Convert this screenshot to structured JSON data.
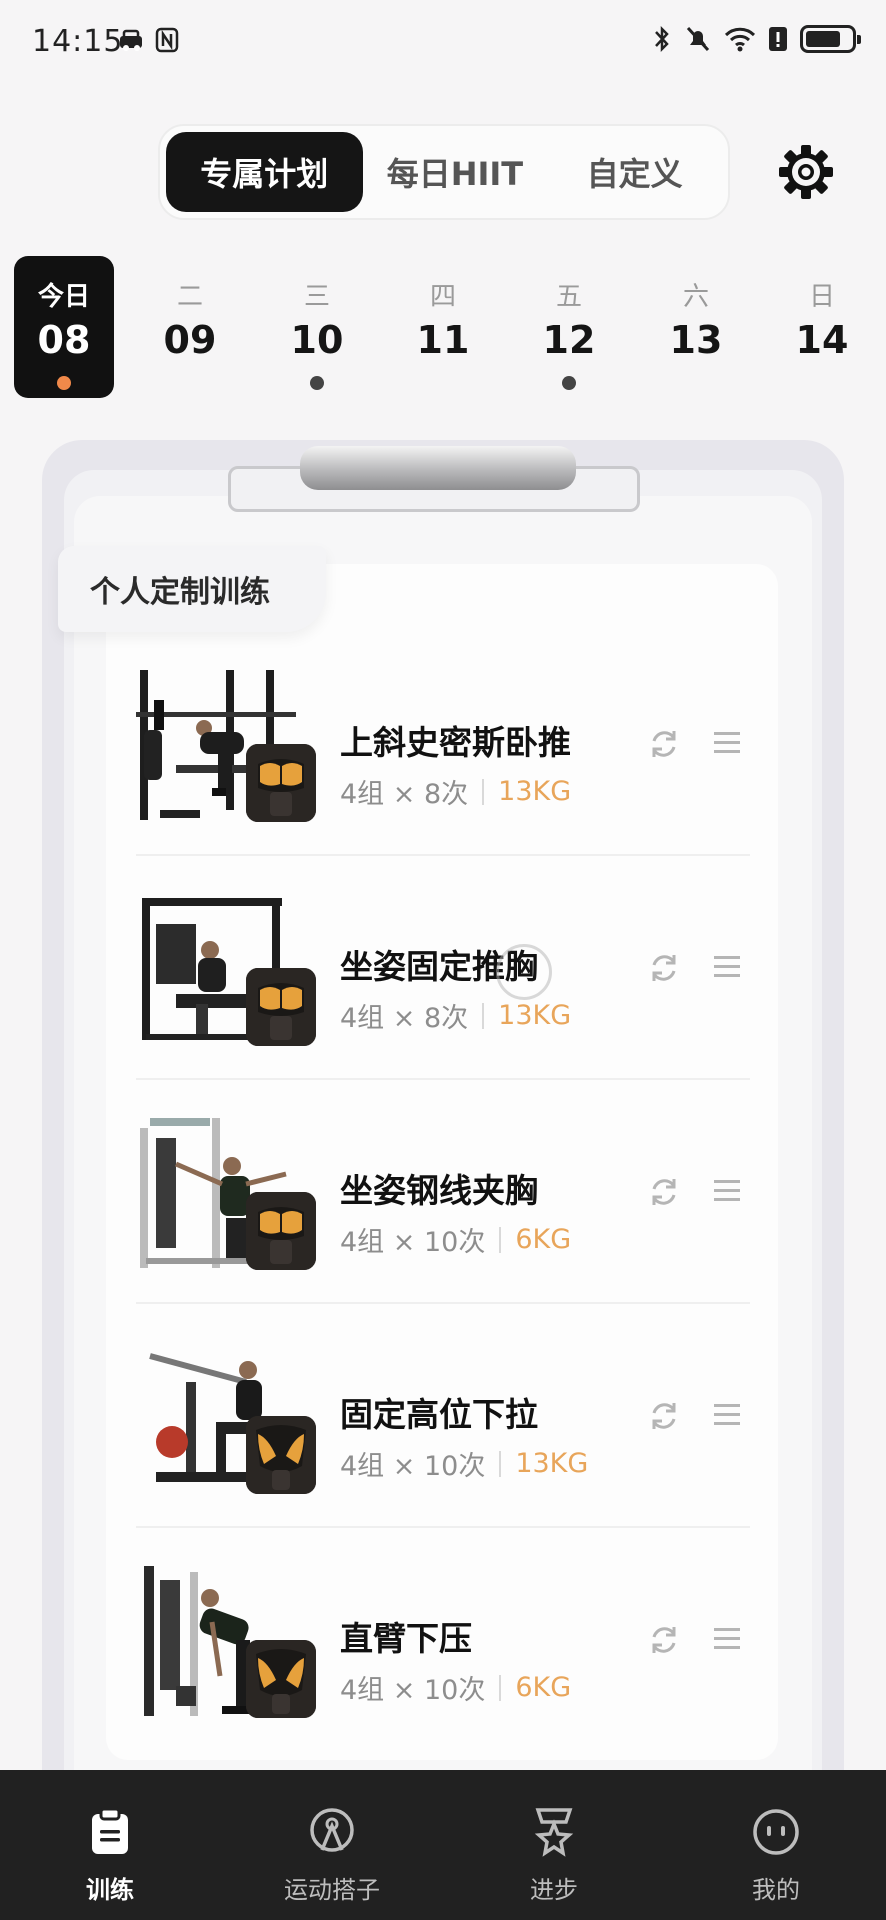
{
  "status_bar": {
    "time": "14:15",
    "left_icons": [
      "car-icon",
      "nfc-icon"
    ],
    "right_icons": [
      "bluetooth-icon",
      "mute-icon",
      "wifi-icon",
      "alert-icon",
      "battery-icon"
    ]
  },
  "mode_tabs": [
    "专属计划",
    "每日HIIT",
    "自定义"
  ],
  "active_mode_tab": "专属计划",
  "week": [
    {
      "weekday": "今日",
      "date": "08",
      "today": true,
      "dot": true
    },
    {
      "weekday": "二",
      "date": "09",
      "today": false,
      "dot": false
    },
    {
      "weekday": "三",
      "date": "10",
      "today": false,
      "dot": true
    },
    {
      "weekday": "四",
      "date": "11",
      "today": false,
      "dot": false
    },
    {
      "weekday": "五",
      "date": "12",
      "today": false,
      "dot": true
    },
    {
      "weekday": "六",
      "date": "13",
      "today": false,
      "dot": false
    },
    {
      "weekday": "日",
      "date": "14",
      "today": false,
      "dot": false
    }
  ],
  "plan": {
    "section_title": "个人定制训练",
    "exercises": [
      {
        "name": "上斜史密斯卧推",
        "sets": "4组 × 8次",
        "weight": "13KG",
        "muscle": "chest"
      },
      {
        "name": "坐姿固定推胸",
        "sets": "4组 × 8次",
        "weight": "13KG",
        "muscle": "chest"
      },
      {
        "name": "坐姿钢线夹胸",
        "sets": "4组 × 10次",
        "weight": "6KG",
        "muscle": "chest"
      },
      {
        "name": "固定高位下拉",
        "sets": "4组 × 10次",
        "weight": "13KG",
        "muscle": "back"
      },
      {
        "name": "直臂下压",
        "sets": "4组 × 10次",
        "weight": "6KG",
        "muscle": "back"
      }
    ]
  },
  "bottom_nav": [
    {
      "label": "训练",
      "icon": "clipboard-icon",
      "active": true
    },
    {
      "label": "运动搭子",
      "icon": "buddy-icon",
      "active": false
    },
    {
      "label": "进步",
      "icon": "medal-icon",
      "active": false
    },
    {
      "label": "我的",
      "icon": "profile-icon",
      "active": false
    }
  ],
  "colors": {
    "accent_orange": "#e8a55a",
    "today_dot": "#f0894a",
    "dark": "#151515",
    "nav_bg": "#212121"
  }
}
